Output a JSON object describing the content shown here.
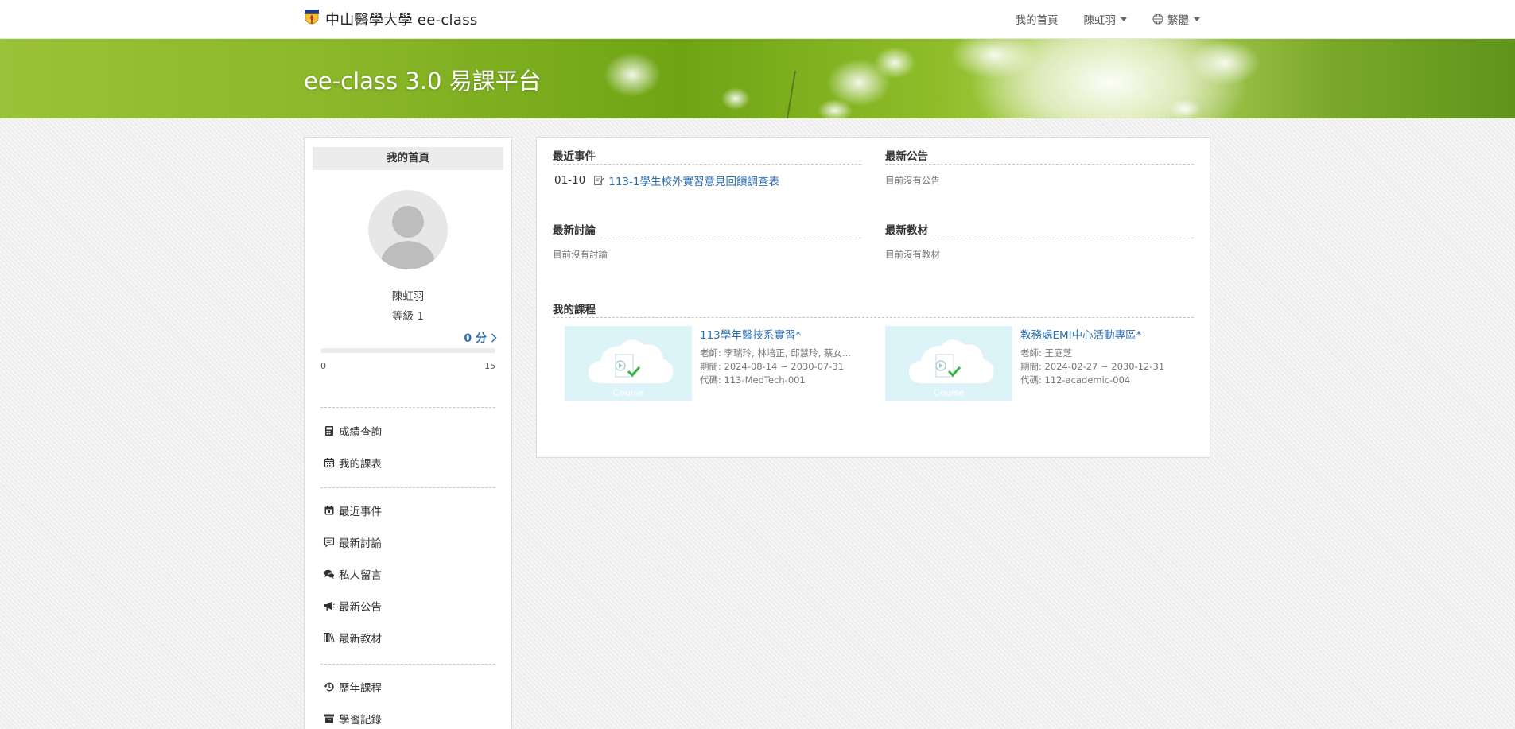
{
  "header": {
    "brand": "中山醫學大學 ee-class",
    "nav": {
      "home": "我的首頁",
      "user": "陳虹羽",
      "language": "繁體"
    }
  },
  "banner": {
    "title": "ee-class 3.0 易課平台"
  },
  "sidebar": {
    "heading": "我的首頁",
    "user": {
      "name": "陳虹羽",
      "level": "等級 1"
    },
    "points": {
      "value": "0 分",
      "min": "0",
      "max": "15",
      "progress_fraction": 0
    },
    "menu": {
      "grades": "成績查詢",
      "timetable": "我的課表",
      "events": "最近事件",
      "discussions": "最新討論",
      "messages": "私人留言",
      "announcements": "最新公告",
      "materials": "最新教材",
      "past_courses": "歷年課程",
      "learning_record": "學習記錄"
    }
  },
  "main": {
    "recent_events": {
      "title": "最近事件",
      "items": [
        {
          "date": "01-10",
          "icon": "survey-icon",
          "label": "113-1學生校外實習意見回饋調查表"
        }
      ]
    },
    "announcements": {
      "title": "最新公告",
      "empty": "目前沒有公告"
    },
    "discussions": {
      "title": "最新討論",
      "empty": "目前沒有討論"
    },
    "materials": {
      "title": "最新教材",
      "empty": "目前沒有教材"
    },
    "courses": {
      "title": "我的課程",
      "thumb_label": "Course",
      "items": [
        {
          "title": "113學年醫技系實習*",
          "teacher": "老師: 李瑞玲, 林培正, 邱慧玲, 蔡女...",
          "period": "期間: 2024-08-14 ~ 2030-07-31",
          "code": "代碼: 113-MedTech-001"
        },
        {
          "title": "教務處EMI中心活動專區*",
          "teacher": "老師: 王庭芝",
          "period": "期間: 2024-02-27 ~ 2030-12-31",
          "code": "代碼: 112-academic-004"
        }
      ]
    }
  },
  "colors": {
    "link": "#2c6fb0",
    "banner_green": "#8bb82a",
    "course_thumb_bg": "#dcf4f7",
    "check_green": "#35b34a"
  }
}
